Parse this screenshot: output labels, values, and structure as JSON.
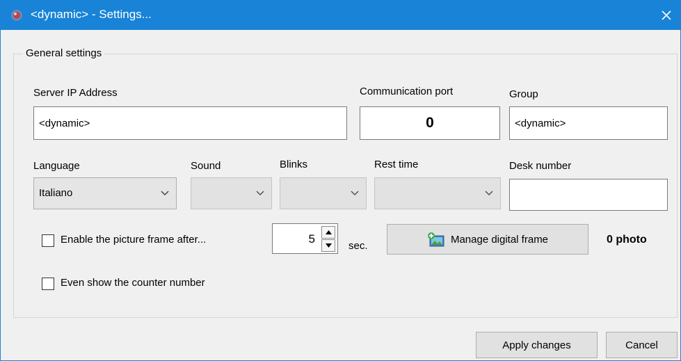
{
  "window": {
    "title": "<dynamic> - Settings...",
    "accent_color": "#1883d7",
    "close_icon": "close-icon",
    "app_icon": "app-icon"
  },
  "general": {
    "legend": "General settings",
    "server_ip": {
      "label": "Server IP Address",
      "value": "<dynamic>"
    },
    "port": {
      "label": "Communication port",
      "value": "0"
    },
    "group": {
      "label": "Group",
      "value": "<dynamic>"
    },
    "language": {
      "label": "Language",
      "value": "Italiano"
    },
    "sound": {
      "label": "Sound",
      "value": ""
    },
    "blinks": {
      "label": "Blinks",
      "value": ""
    },
    "rest_time": {
      "label": "Rest time",
      "value": ""
    },
    "desk_number": {
      "label": "Desk number",
      "value": ""
    },
    "picture_frame": {
      "checkbox_label": "Enable the picture frame after...",
      "checked": false,
      "seconds_value": "5",
      "seconds_unit": "sec.",
      "manage_button": "Manage digital frame",
      "manage_icon": "picture-frame-icon",
      "photo_count": "0 photo"
    },
    "counter": {
      "checkbox_label": "Even show the counter number",
      "checked": false
    }
  },
  "footer": {
    "apply_label": "Apply changes",
    "cancel_label": "Cancel"
  }
}
